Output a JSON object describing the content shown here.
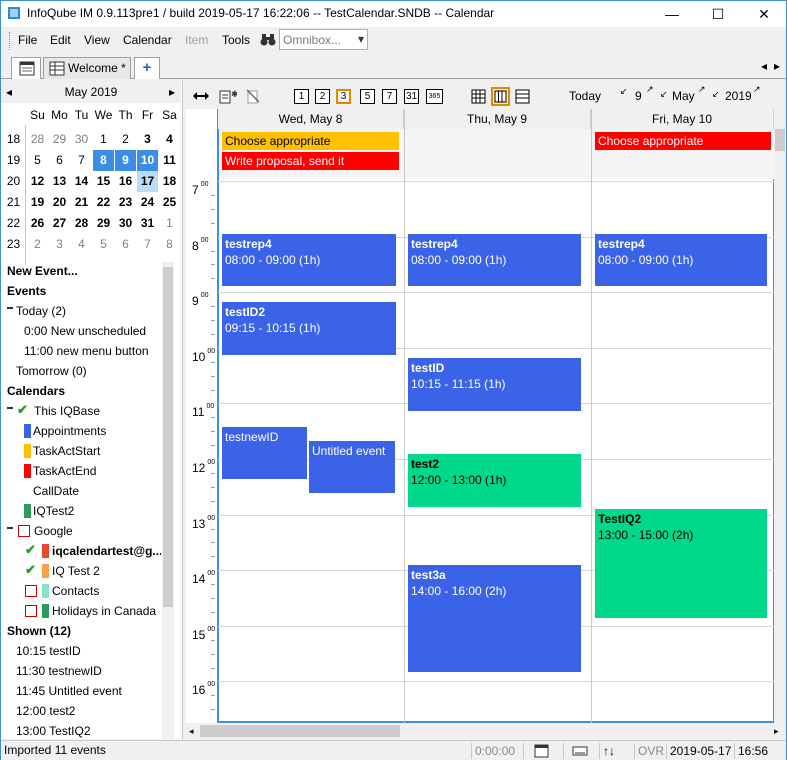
{
  "window": {
    "title": "InfoQube IM 0.9.113pre1 /  build 2019-05-17 16:22:06 -- TestCalendar.SNDB -- Calendar",
    "minimize": "—",
    "maximize": "☐",
    "close": "✕"
  },
  "menu": {
    "file": "File",
    "edit": "Edit",
    "view": "View",
    "calendar": "Calendar",
    "item": "Item",
    "tools": "Tools",
    "binoculars_icon": "binoculars",
    "omnibox_placeholder": "Omnibox...",
    "omnibox_arrow": "▾"
  },
  "tabs": {
    "welcome": "Welcome *",
    "add": "+",
    "nav_left": "◂",
    "nav_right": "▸"
  },
  "mini_calendar": {
    "month": "May 2019",
    "prev": "◂",
    "next": "▸",
    "weekday_headers": [
      "Su",
      "Mo",
      "Tu",
      "We",
      "Th",
      "Fr",
      "Sa"
    ],
    "weeks": [
      {
        "num": "18",
        "days": [
          "28",
          "29",
          "30",
          "1",
          "2",
          "3",
          "4"
        ]
      },
      {
        "num": "19",
        "days": [
          "5",
          "6",
          "7",
          "8",
          "9",
          "10",
          "11"
        ]
      },
      {
        "num": "20",
        "days": [
          "12",
          "13",
          "14",
          "15",
          "16",
          "17",
          "18"
        ]
      },
      {
        "num": "21",
        "days": [
          "19",
          "20",
          "21",
          "22",
          "23",
          "24",
          "25"
        ]
      },
      {
        "num": "22",
        "days": [
          "26",
          "27",
          "28",
          "29",
          "30",
          "31",
          "1"
        ]
      },
      {
        "num": "23",
        "days": [
          "2",
          "3",
          "4",
          "5",
          "6",
          "7",
          "8"
        ]
      }
    ]
  },
  "tree": {
    "new_event": "New Event...",
    "events": "Events",
    "today": "Today (2)",
    "today_items": [
      "0:00 New unscheduled",
      "11:00 new menu button"
    ],
    "tomorrow": "Tomorrow (0)",
    "calendars": "Calendars",
    "this_iqbase": "This IQBase",
    "iq_cals": [
      {
        "label": "Appointments",
        "color": "#3a63e8"
      },
      {
        "label": "TaskActStart",
        "color": "#ffc000"
      },
      {
        "label": "TaskActEnd",
        "color": "#ff0000"
      },
      {
        "label": "CallDate",
        "color": ""
      },
      {
        "label": "IQTest2",
        "color": "#2e9a5a"
      }
    ],
    "google": "Google",
    "google_cals": [
      {
        "label": "iqcalendartest@g...",
        "color": "#e8462e"
      },
      {
        "label": "IQ Test 2",
        "color": "#f6a34b"
      },
      {
        "label": "Contacts",
        "color": "#8fe0c8"
      },
      {
        "label": "Holidays in Canada",
        "color": "#2e9a5a"
      }
    ],
    "shown": "Shown (12)",
    "shown_items": [
      "10:15 testID",
      "11:30 testnewID",
      "11:45 Untitled event",
      "12:00 test2",
      "13:00 TestIQ2"
    ]
  },
  "cal_toolbar": {
    "views": [
      "1",
      "2",
      "3",
      "5",
      "7",
      "31",
      "365"
    ],
    "today": "Today",
    "day_nav": "9",
    "month_nav": "May",
    "year_nav": "2019"
  },
  "days": [
    {
      "header": "Wed, May 8"
    },
    {
      "header": "Thu, May 9"
    },
    {
      "header": "Fri, May 10"
    }
  ],
  "hours": [
    "7",
    "8",
    "9",
    "10",
    "11",
    "12",
    "13",
    "14",
    "15",
    "16"
  ],
  "allday_events": [
    {
      "day": 0,
      "label": "Choose appropriate",
      "color": "#ffc000"
    },
    {
      "day": 0,
      "label": "Write proposal, send it",
      "color": "#ff0000"
    },
    {
      "day": 2,
      "label": "Choose appropriate",
      "color": "#ff0000"
    }
  ],
  "events": [
    {
      "day": 0,
      "title": "testrep4",
      "time": "08:00 - 09:00 (1h)",
      "style": "blue"
    },
    {
      "day": 1,
      "title": "testrep4",
      "time": "08:00 - 09:00 (1h)",
      "style": "blue"
    },
    {
      "day": 2,
      "title": "testrep4",
      "time": "08:00 - 09:00 (1h)",
      "style": "blue"
    },
    {
      "day": 0,
      "title": "testID2",
      "time": "09:15 - 10:15 (1h)",
      "style": "blue"
    },
    {
      "day": 1,
      "title": "testID",
      "time": "10:15 - 11:15 (1h)",
      "style": "blue"
    },
    {
      "day": 0,
      "title": "testnewID",
      "time": "",
      "style": "blue"
    },
    {
      "day": 0,
      "title": "Untitled event",
      "time": "",
      "style": "blue"
    },
    {
      "day": 1,
      "title": "test2",
      "time": "12:00 - 13:00 (1h)",
      "style": "green"
    },
    {
      "day": 2,
      "title": "TestIQ2",
      "time": "13:00 - 15:00 (2h)",
      "style": "green"
    },
    {
      "day": 1,
      "title": "test3a",
      "time": "14:00 - 16:00 (2h)",
      "style": "blue"
    }
  ],
  "status": {
    "message": "Imported 11 events",
    "timer": "0:00:00",
    "ovr": "OVR",
    "date": "2019-05-17",
    "time": "16:56"
  }
}
